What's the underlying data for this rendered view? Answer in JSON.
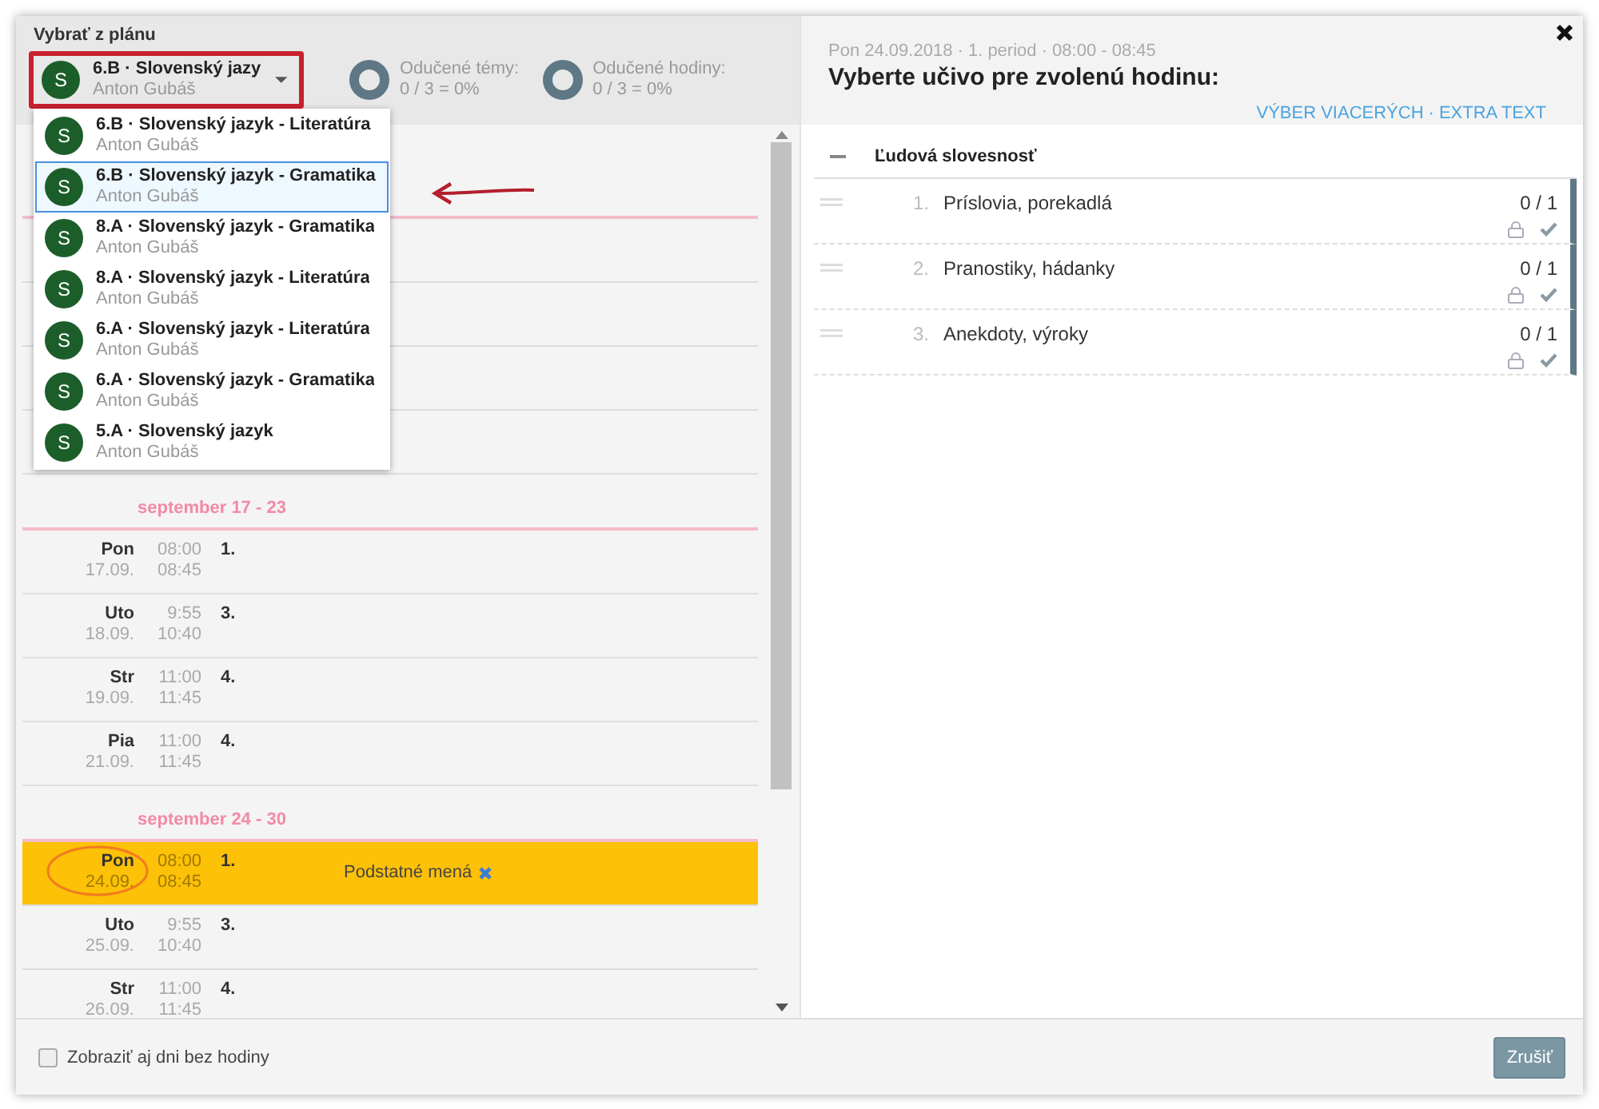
{
  "left_header": {
    "label": "Vybrať z plánu",
    "selector": {
      "avatar": "S",
      "title": "6.B · Slovenský jazy",
      "teacher": "Anton Gubáš"
    },
    "stats": [
      {
        "label": "Odučené témy:",
        "value": "0 / 3 = 0%"
      },
      {
        "label": "Odučené hodiny:",
        "value": "0 / 3 = 0%"
      }
    ]
  },
  "dropdown": {
    "items": [
      {
        "avatar": "S",
        "title": "6.B · Slovenský jazyk - Literatúra",
        "teacher": "Anton Gubáš",
        "selected": false
      },
      {
        "avatar": "S",
        "title": "6.B · Slovenský jazyk - Gramatika",
        "teacher": "Anton Gubáš",
        "selected": true
      },
      {
        "avatar": "S",
        "title": "8.A · Slovenský jazyk - Gramatika",
        "teacher": "Anton Gubáš",
        "selected": false
      },
      {
        "avatar": "S",
        "title": "8.A · Slovenský jazyk - Literatúra",
        "teacher": "Anton Gubáš",
        "selected": false
      },
      {
        "avatar": "S",
        "title": "6.A · Slovenský jazyk - Literatúra",
        "teacher": "Anton Gubáš",
        "selected": false
      },
      {
        "avatar": "S",
        "title": "6.A · Slovenský jazyk - Gramatika",
        "teacher": "Anton Gubáš",
        "selected": false
      },
      {
        "avatar": "S",
        "title": "5.A · Slovenský jazyk",
        "teacher": "Anton Gubáš",
        "selected": false
      }
    ]
  },
  "weeks": [
    {
      "label": "september 17 - 23",
      "lessons": [
        {
          "day": "Pon",
          "date": "17.09.",
          "start": "08:00",
          "end": "08:45",
          "period": "1.",
          "selected": false
        },
        {
          "day": "Uto",
          "date": "18.09.",
          "start": "9:55",
          "end": "10:40",
          "period": "3.",
          "selected": false
        },
        {
          "day": "Str",
          "date": "19.09.",
          "start": "11:00",
          "end": "11:45",
          "period": "4.",
          "selected": false
        },
        {
          "day": "Pia",
          "date": "21.09.",
          "start": "11:00",
          "end": "11:45",
          "period": "4.",
          "selected": false
        }
      ]
    },
    {
      "label": "september 24 - 30",
      "lessons": [
        {
          "day": "Pon",
          "date": "24.09.",
          "start": "08:00",
          "end": "08:45",
          "period": "1.",
          "topic": "Podstatné mená",
          "selected": true
        },
        {
          "day": "Uto",
          "date": "25.09.",
          "start": "9:55",
          "end": "10:40",
          "period": "3.",
          "selected": false
        },
        {
          "day": "Str",
          "date": "26.09.",
          "start": "11:00",
          "end": "11:45",
          "period": "4.",
          "selected": false
        }
      ]
    }
  ],
  "footer": {
    "checkbox": {
      "label": "Zobraziť aj dni bez hodiny",
      "checked": false
    },
    "cancel": "Zrušiť"
  },
  "right": {
    "subtitle": "Pon 24.09.2018 · 1. period · 08:00 - 08:45",
    "title": "Vyberte učivo pre zvolenú hodinu:",
    "links": [
      "VÝBER VIACERÝCH",
      "EXTRA TEXT"
    ],
    "link_separator": "·",
    "topic": {
      "title": "Ľudová slovesnosť",
      "expanded": true,
      "items": [
        {
          "number": "1.",
          "title": "Príslovia, porekadlá",
          "count": "0 / 1"
        },
        {
          "number": "2.",
          "title": "Pranostiky, hádanky",
          "count": "0 / 1"
        },
        {
          "number": "3.",
          "title": "Anekdoty, výroky",
          "count": "0 / 1"
        }
      ]
    }
  }
}
